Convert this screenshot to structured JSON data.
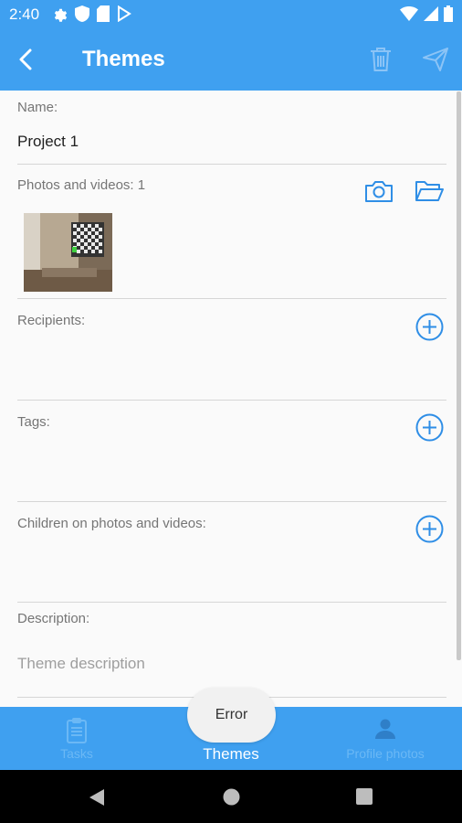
{
  "status_bar": {
    "time": "2:40"
  },
  "app_bar": {
    "title": "Themes"
  },
  "form": {
    "name": {
      "label": "Name:",
      "value": "Project 1"
    },
    "photos": {
      "label": "Photos and videos: 1"
    },
    "recipients": {
      "label": "Recipients:"
    },
    "tags": {
      "label": "Tags:"
    },
    "children": {
      "label": "Children on photos and videos:"
    },
    "description": {
      "label": "Description:",
      "placeholder": "Theme description"
    }
  },
  "bottom_nav": {
    "items": [
      {
        "label": "Tasks",
        "active": false
      },
      {
        "label": "Themes",
        "active": true
      },
      {
        "label": "Profile photos",
        "active": false
      }
    ]
  },
  "toast": {
    "text": "Error"
  },
  "colors": {
    "primary": "#3fa0f0",
    "accent_icon": "#2f8ee6",
    "inactive_nav": "#6bb8f5"
  }
}
